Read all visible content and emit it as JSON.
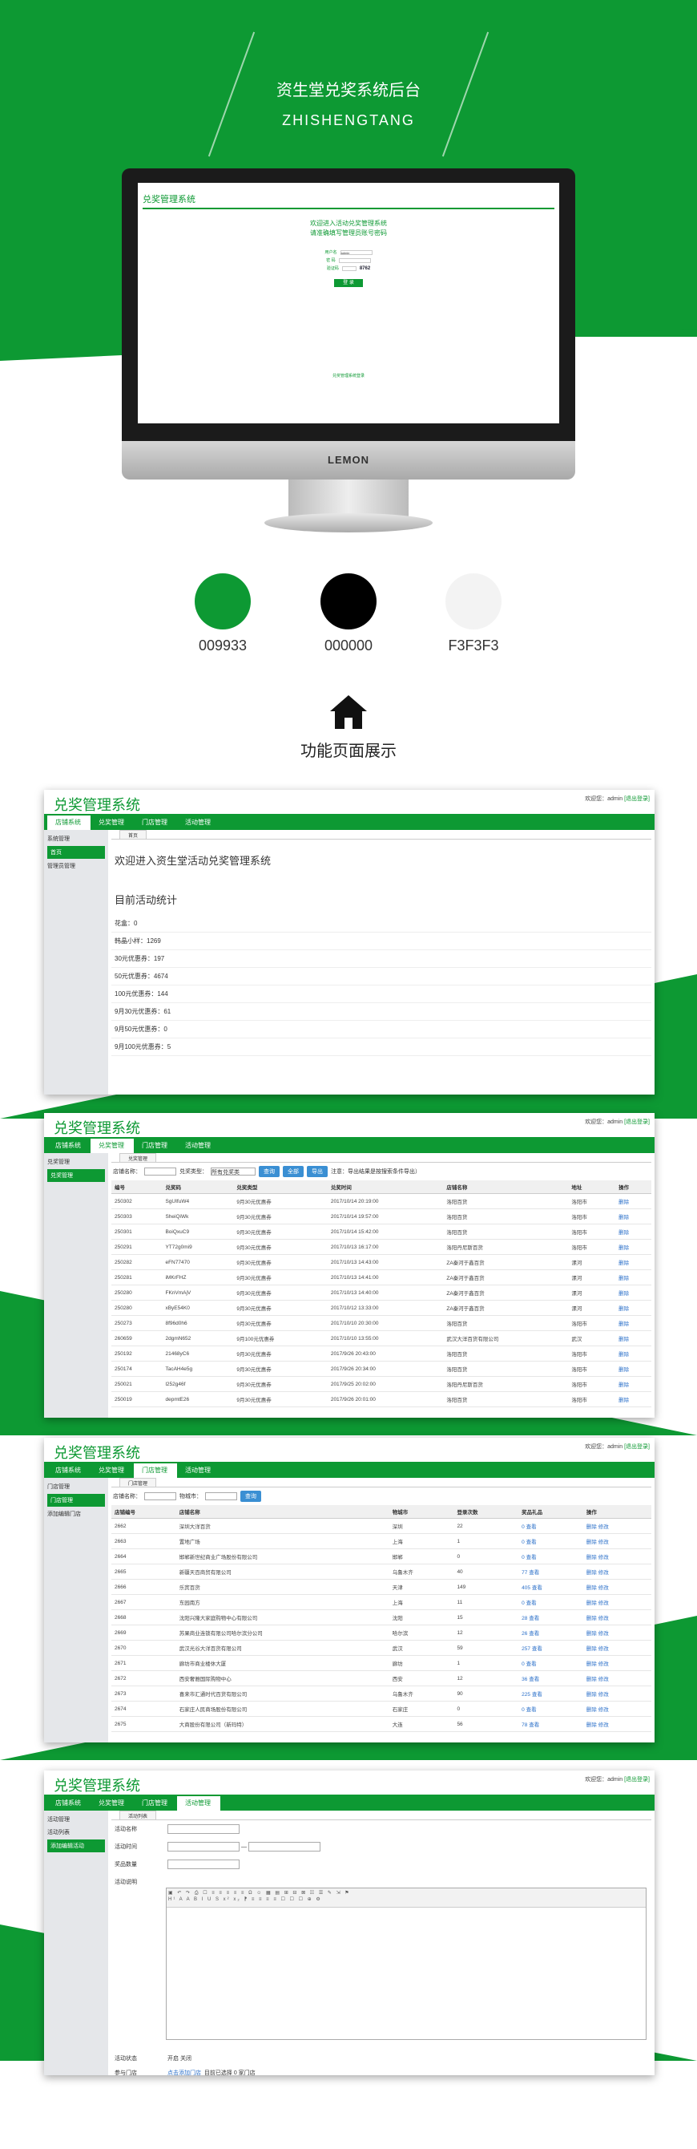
{
  "hero": {
    "title": "资生堂兑奖系统后台",
    "subtitle": "ZHISHENGTANG"
  },
  "monitor": {
    "brand": "LEMON",
    "screen_title": "兑奖管理系统",
    "welcome1": "欢迎进入活动兑奖管理系统",
    "welcome2": "请准确填写管理员账号密码",
    "user_label": "用户名",
    "user_value": "admin",
    "pwd_label": "密 码",
    "code_label": "验证码",
    "code_value": "8762",
    "btn": "登 录",
    "footer": "兑奖管理系统登录"
  },
  "colors": [
    {
      "hex": "#0d9933",
      "label": "009933"
    },
    {
      "hex": "#000000",
      "label": "000000"
    },
    {
      "hex": "#f3f3f3",
      "label": "F3F3F3"
    }
  ],
  "section_title": "功能页面展示",
  "common": {
    "app_title": "兑奖管理系统",
    "user_text": "欢迎您：admin",
    "logout": "[退出登录]",
    "nav": [
      "店铺系统",
      "兑奖管理",
      "门店管理",
      "活动管理"
    ]
  },
  "shot1": {
    "side": [
      "系统管理",
      "首页",
      "管理员管理"
    ],
    "tab": "首页",
    "h1": "欢迎进入资生堂活动兑奖管理系统",
    "h2": "目前活动统计",
    "stats": [
      "花盒：0",
      "韩晶小样：1269",
      "30元优惠券：197",
      "50元优惠券：4674",
      "100元优惠券：144",
      "9月30元优惠券：61",
      "9月50元优惠券：0",
      "9月100元优惠券：5"
    ]
  },
  "shot2": {
    "side": [
      "兑奖管理",
      "兑奖管理"
    ],
    "tab": "兑奖管理",
    "toolbar": {
      "shop_label": "店铺名称：",
      "type_label": "兑奖类型：",
      "type_value": "所有兑奖类",
      "query": "查询",
      "all": "全部",
      "export": "导出",
      "note": "注意：导出结果是按搜索条件导出）"
    },
    "headers": [
      "编号",
      "兑奖码",
      "兑奖类型",
      "兑奖时间",
      "店铺名称",
      "地址",
      "操作"
    ],
    "rows": [
      [
        "250302",
        "SgUIfuW4",
        "9月30元优惠券",
        "2017/10/14 20:19:00",
        "洛阳百货",
        "洛阳市",
        "删除"
      ],
      [
        "250303",
        "SheiQiWk",
        "9月30元优惠券",
        "2017/10/14 19:57:00",
        "洛阳百货",
        "洛阳市",
        "删除"
      ],
      [
        "250301",
        "BoiQxuC9",
        "9月30元优惠券",
        "2017/10/14 15:42:00",
        "洛阳百货",
        "洛阳市",
        "删除"
      ],
      [
        "250291",
        "YT72g0mi9",
        "9月30元优惠券",
        "2017/10/13 16:17:00",
        "洛阳丹尼斯百货",
        "洛阳市",
        "删除"
      ],
      [
        "250282",
        "eFN77470",
        "9月30元优惠券",
        "2017/10/13 14:43:00",
        "ZA秦河于鑫百货",
        "漯河",
        "删除"
      ],
      [
        "250281",
        "iMKrFHZ",
        "9月30元优惠券",
        "2017/10/13 14:41:00",
        "ZA秦河于鑫百货",
        "漯河",
        "删除"
      ],
      [
        "250280",
        "FKnVmAjV",
        "9月30元优惠券",
        "2017/10/13 14:40:00",
        "ZA秦河于鑫百货",
        "漯河",
        "删除"
      ],
      [
        "250280",
        "xByE54K0",
        "9月30元优惠券",
        "2017/10/12 13:33:00",
        "ZA秦河于鑫百货",
        "漯河",
        "删除"
      ],
      [
        "250273",
        "8f96d0h6",
        "9月30元优惠券",
        "2017/10/10 20:30:00",
        "洛阳百货",
        "洛阳市",
        "删除"
      ],
      [
        "260659",
        "2dgmN652",
        "9月100元优惠券",
        "2017/10/10 13:55:00",
        "武汉大洋百货有限公司",
        "武汉",
        "删除"
      ],
      [
        "250192",
        "21468yC6",
        "9月30元优惠券",
        "2017/9/26 20:43:00",
        "洛阳百货",
        "洛阳市",
        "删除"
      ],
      [
        "250174",
        "TacAH4e5g",
        "9月30元优惠券",
        "2017/9/26 20:34:00",
        "洛阳百货",
        "洛阳市",
        "删除"
      ],
      [
        "250021",
        "l252g46f",
        "9月30元优惠券",
        "2017/9/25 20:02:00",
        "洛阳丹尼斯百货",
        "洛阳市",
        "删除"
      ],
      [
        "250019",
        "depmtE26",
        "9月30元优惠券",
        "2017/9/26 20:01:00",
        "洛阳百货",
        "洛阳市",
        "删除"
      ]
    ]
  },
  "shot3": {
    "side": [
      "门店管理",
      "门店管理",
      "添加编辑门店"
    ],
    "tab": "门店管理",
    "toolbar": {
      "shop_label": "店铺名称：",
      "city_label": "物城市：",
      "query": "查询"
    },
    "headers": [
      "店铺编号",
      "店铺名称",
      "物城市",
      "登录次数",
      "奖品礼品",
      "操作"
    ],
    "rows": [
      [
        "2662",
        "深圳大洋百货",
        "深圳",
        "22",
        "0 查看",
        "删除 修改"
      ],
      [
        "2663",
        "置地广场",
        "上海",
        "1",
        "0 查看",
        "删除 修改"
      ],
      [
        "2664",
        "邯郸新世纪商业广场股份有限公司",
        "邯郸",
        "0",
        "0 查看",
        "删除 修改"
      ],
      [
        "2665",
        "新疆天百商贸有限公司",
        "乌鲁木齐",
        "40",
        "77 查看",
        "删除 修改"
      ],
      [
        "2666",
        "乐宾百货",
        "天津",
        "149",
        "405 查看",
        "删除 修改"
      ],
      [
        "2667",
        "东园南方",
        "上海",
        "11",
        "0 查看",
        "删除 修改"
      ],
      [
        "2668",
        "沈阳兴隆大家庭购物中心有限公司",
        "沈阳",
        "15",
        "28 查看",
        "删除 修改"
      ],
      [
        "2669",
        "苏果商业连锁有限公司哈尔滨分公司",
        "哈尔滨",
        "12",
        "26 查看",
        "删除 修改"
      ],
      [
        "2670",
        "武汉光谷大洋百货有限公司",
        "武汉",
        "59",
        "257 查看",
        "删除 修改"
      ],
      [
        "2671",
        "廊坊市商业楼休大厦",
        "廊坊",
        "1",
        "0 查看",
        "删除 修改"
      ],
      [
        "2672",
        "西安奢雅国际购物中心",
        "西安",
        "12",
        "36 查看",
        "删除 修改"
      ],
      [
        "2673",
        "喜来市汇通时代百货有限公司",
        "乌鲁木齐",
        "90",
        "225 查看",
        "删除 修改"
      ],
      [
        "2674",
        "石家庄人民商场股份有限公司",
        "石家庄",
        "0",
        "0 查看",
        "删除 修改"
      ],
      [
        "2675",
        "大商股份有限公司（新玛特）",
        "大连",
        "56",
        "78 查看",
        "删除 修改"
      ]
    ]
  },
  "shot4": {
    "side": [
      "活动管理",
      "活动列表",
      "添加编辑活动"
    ],
    "tab": "活动列表",
    "labels": [
      "活动名称",
      "活动时间",
      "奖品数量",
      "活动说明"
    ],
    "status_label": "活动状态",
    "status_value": "开启 关闭",
    "shop_label": "参与门店",
    "shop_value": "点击添加门店",
    "shop_note": "目前已选择 0 家门店"
  }
}
